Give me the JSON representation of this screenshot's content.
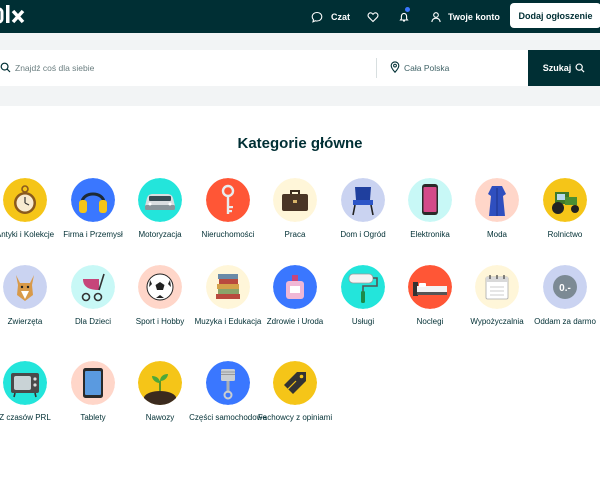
{
  "header": {
    "logo_text": "olx",
    "chat_label": "Czat",
    "account_label": "Twoje konto",
    "post_ad_label": "Dodaj ogłoszenie"
  },
  "search": {
    "placeholder": "Znajdź coś dla siebie",
    "location": "Cała Polska",
    "button_label": "Szukaj"
  },
  "categories": {
    "title": "Kategorie główne",
    "items": [
      {
        "label": "Antyki i Kolekcje",
        "icon": "pocket-watch-icon",
        "color": "#f5c518"
      },
      {
        "label": "Firma i Przemysł",
        "icon": "ear-muffs-icon",
        "color": "#3a77ff"
      },
      {
        "label": "Motoryzacja",
        "icon": "car-icon",
        "color": "#23e5db"
      },
      {
        "label": "Nieruchomości",
        "icon": "key-icon",
        "color": "#ff5636"
      },
      {
        "label": "Praca",
        "icon": "briefcase-icon",
        "color": "#fff6d9"
      },
      {
        "label": "Dom i Ogród",
        "icon": "chair-icon",
        "color": "#cad3f1"
      },
      {
        "label": "Elektronika",
        "icon": "smartphone-icon",
        "color": "#c8f8f6"
      },
      {
        "label": "Moda",
        "icon": "dress-icon",
        "color": "#ffd6c9"
      },
      {
        "label": "Rolnictwo",
        "icon": "tractor-icon",
        "color": "#f5c518"
      },
      {
        "label": "Zwierzęta",
        "icon": "dog-icon",
        "color": "#cad3f1"
      },
      {
        "label": "Dla Dzieci",
        "icon": "stroller-icon",
        "color": "#c8f8f6"
      },
      {
        "label": "Sport i Hobby",
        "icon": "soccer-ball-icon",
        "color": "#ffd6c9"
      },
      {
        "label": "Muzyka i Edukacja",
        "icon": "books-icon",
        "color": "#fff6d9"
      },
      {
        "label": "Zdrowie i Uroda",
        "icon": "perfume-icon",
        "color": "#3a77ff"
      },
      {
        "label": "Usługi",
        "icon": "paint-roller-icon",
        "color": "#23e5db"
      },
      {
        "label": "Noclegi",
        "icon": "bed-icon",
        "color": "#ff5636"
      },
      {
        "label": "Wypożyczalnia",
        "icon": "calendar-icon",
        "color": "#fff6d9"
      },
      {
        "label": "Oddam za darmo",
        "icon": "zero-price-icon",
        "color": "#cad3f1"
      },
      {
        "label": "Z czasów PRL",
        "icon": "retro-tv-icon",
        "color": "#23e5db"
      },
      {
        "label": "Tablety",
        "icon": "tablet-icon",
        "color": "#ffd6c9"
      },
      {
        "label": "Nawozy",
        "icon": "sprout-icon",
        "color": "#f5c518"
      },
      {
        "label": "Części samochodowe",
        "icon": "piston-icon",
        "color": "#3a77ff"
      },
      {
        "label": "Fachowcy z opiniami",
        "icon": "tag-icon",
        "color": "#f5c518"
      }
    ]
  }
}
